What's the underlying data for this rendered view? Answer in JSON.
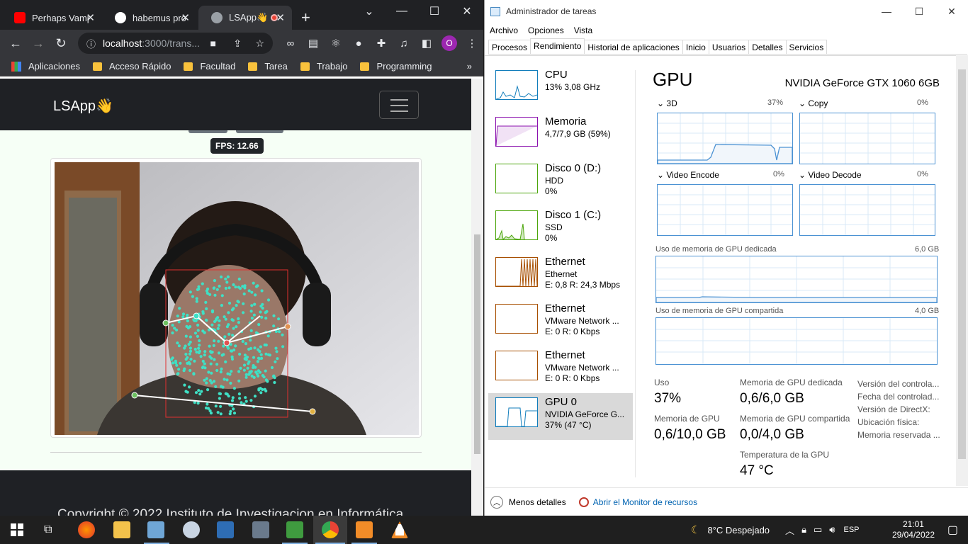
{
  "browser": {
    "tabs": [
      {
        "title": "Perhaps Vamp",
        "icon": "youtube-icon",
        "color": "#ff0000"
      },
      {
        "title": "habemus pro",
        "icon": "github-icon",
        "color": "#ffffff"
      },
      {
        "title": "LSApp👋",
        "icon": "globe-icon",
        "color": "#9aa0a6"
      }
    ],
    "url_host": "localhost",
    "url_path": ":3000/trans...",
    "bookmarks": [
      "Aplicaciones",
      "Acceso Rápido",
      "Facultad",
      "Tarea",
      "Trabajo",
      "Programming"
    ],
    "profile_initial": "O"
  },
  "page": {
    "brand": "LSApp👋",
    "fps_label": "FPS: 12.66",
    "footer": "Copyright © 2022 Instituto de Investigacion en Informática"
  },
  "taskmgr": {
    "title": "Administrador de tareas",
    "menu": [
      "Archivo",
      "Opciones",
      "Vista"
    ],
    "tabs": [
      "Procesos",
      "Rendimiento",
      "Historial de aplicaciones",
      "Inicio",
      "Usuarios",
      "Detalles",
      "Servicios"
    ],
    "active_tab": "Rendimiento",
    "sidebar": [
      {
        "name": "CPU",
        "line1": "13%  3,08 GHz",
        "line2": "",
        "color": "#117dbb"
      },
      {
        "name": "Memoria",
        "line1": "4,7/7,9 GB (59%)",
        "line2": "",
        "color": "#8b12ae"
      },
      {
        "name": "Disco 0 (D:)",
        "line1": "HDD",
        "line2": "0%",
        "color": "#4da60c"
      },
      {
        "name": "Disco 1 (C:)",
        "line1": "SSD",
        "line2": "0%",
        "color": "#4da60c"
      },
      {
        "name": "Ethernet",
        "line1": "Ethernet",
        "line2": "E: 0,8  R: 24,3 Mbps",
        "color": "#a74f01"
      },
      {
        "name": "Ethernet",
        "line1": "VMware Network ...",
        "line2": "E: 0  R: 0 Kbps",
        "color": "#a74f01"
      },
      {
        "name": "Ethernet",
        "line1": "VMware Network ...",
        "line2": "E: 0  R: 0 Kbps",
        "color": "#a74f01"
      },
      {
        "name": "GPU 0",
        "line1": "NVIDIA GeForce G...",
        "line2": "37%  (47 °C)",
        "color": "#117dbb"
      }
    ],
    "gpu": {
      "title": "GPU",
      "model": "NVIDIA GeForce GTX 1060 6GB",
      "engines": [
        {
          "name": "3D",
          "pct": "37%"
        },
        {
          "name": "Copy",
          "pct": "0%"
        },
        {
          "name": "Video Encode",
          "pct": "0%"
        },
        {
          "name": "Video Decode",
          "pct": "0%"
        }
      ],
      "dedicated_label": "Uso de memoria de GPU dedicada",
      "dedicated_max": "6,0 GB",
      "shared_label": "Uso de memoria de GPU compartida",
      "shared_max": "4,0 GB",
      "stats": {
        "uso_l": "Uso",
        "uso_v": "37%",
        "ded_l": "Memoria de GPU dedicada",
        "ded_v": "0,6/6,0 GB",
        "mem_l": "Memoria de GPU",
        "mem_v": "0,6/10,0 GB",
        "sh_l": "Memoria de GPU compartida",
        "sh_v": "0,0/4,0 GB",
        "temp_l": "Temperatura de la GPU",
        "temp_v": "47 °C"
      },
      "info": [
        "Versión del controla...",
        "Fecha del controlad...",
        "Versión de DirectX:",
        "Ubicación física:",
        "Memoria reservada ..."
      ]
    },
    "less_details": "Menos detalles",
    "resource_monitor": "Abrir el Monitor de recursos"
  },
  "taskbar": {
    "weather": "8°C  Despejado",
    "lang": "ESP",
    "time": "21:01",
    "date": "29/04/2022"
  }
}
